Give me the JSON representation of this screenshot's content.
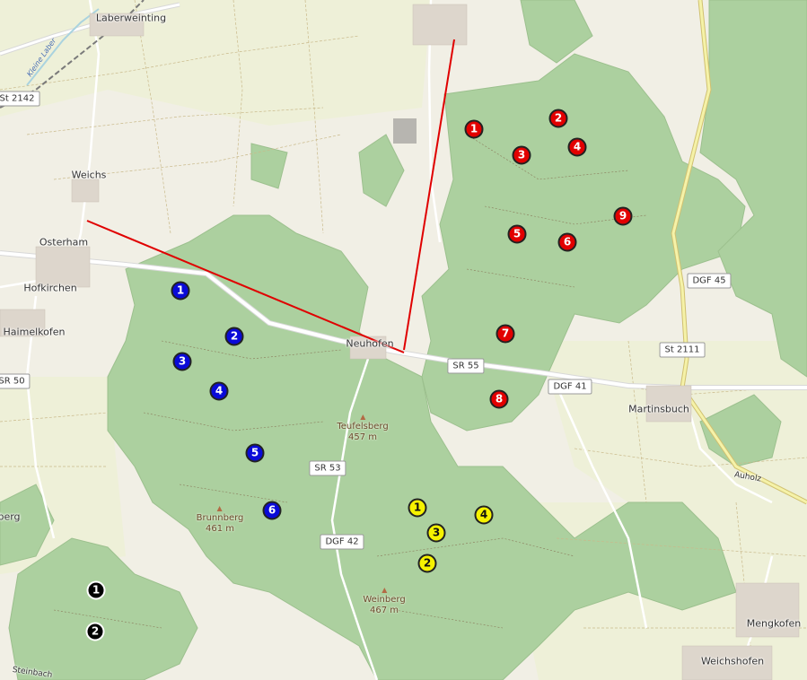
{
  "places": {
    "laberweinting": "Laberweinting",
    "weichs": "Weichs",
    "osterham": "Osterham",
    "hofkirchen": "Hofkirchen",
    "haimelkofen": "Haimelkofen",
    "neuhofen": "Neuhofen",
    "martinsbuch": "Martinsbuch",
    "mengkofen": "Mengkofen",
    "weichshofen": "Weichshofen",
    "auholz": "Auholz",
    "berg_partial": "berg",
    "steinbach_partial": "Steinbach",
    "river": "Kleine Laber"
  },
  "peaks": {
    "teufelsberg": {
      "name": "Teufelsberg",
      "elev": "457 m"
    },
    "brunnberg": {
      "name": "Brunnberg",
      "elev": "461 m"
    },
    "weinberg": {
      "name": "Weinberg",
      "elev": "467 m"
    }
  },
  "roads": {
    "st2142": "St 2142",
    "dgf45": "DGF 45",
    "st2111": "St 2111",
    "sr55": "SR 55",
    "dgf41": "DGF 41",
    "sr50": "SR 50",
    "sr53": "SR 53",
    "dgf42": "DGF 42"
  },
  "marker_colors": {
    "red": "#e20000",
    "blue": "#0a0ad8",
    "yellow": "#f6f200",
    "black": "#000000"
  },
  "markers": {
    "red": [
      "1",
      "2",
      "3",
      "4",
      "5",
      "6",
      "7",
      "8",
      "9"
    ],
    "blue": [
      "1",
      "2",
      "3",
      "4",
      "5",
      "6"
    ],
    "yellow": [
      "1",
      "2",
      "3",
      "4"
    ],
    "black": [
      "1",
      "2"
    ]
  }
}
